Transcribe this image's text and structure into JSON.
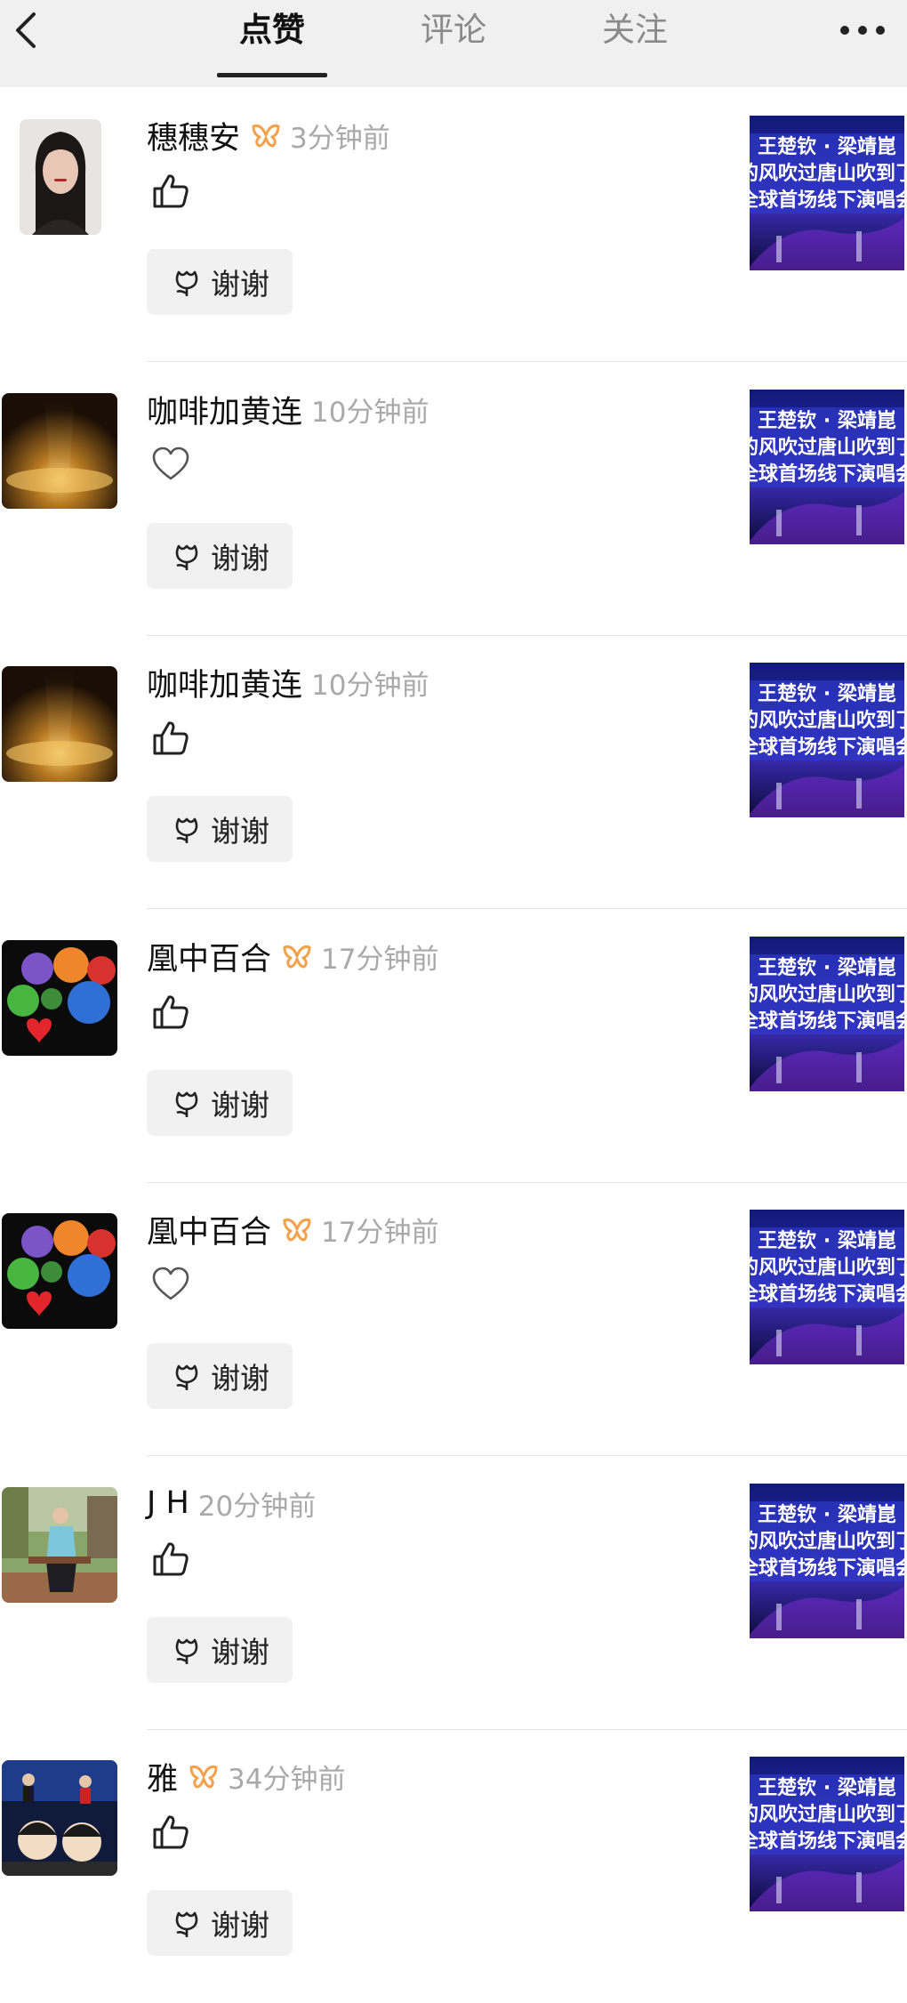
{
  "header": {
    "tabs": [
      {
        "label": "点赞",
        "active": true
      },
      {
        "label": "评论",
        "active": false
      },
      {
        "label": "关注",
        "active": false
      }
    ],
    "back_icon": "chevron-left-icon",
    "more_icon": "more-dots-icon"
  },
  "thanks_label": "谢谢",
  "thumb_text": {
    "line1": "王楚钦 · 梁靖崑",
    "line2": "的风吹过唐山吹到了",
    "line3": "全球首场线下演唱会"
  },
  "colors": {
    "vip_badge": "#f3a14a",
    "tab_active": "#111111",
    "tab_inactive": "#8a8a8a",
    "time_gray": "#a9a9a9"
  },
  "items": [
    {
      "name": "穗穗安",
      "vip": true,
      "time": "3分钟前",
      "reaction": "thumbs-up-icon",
      "avatar": "portrait"
    },
    {
      "name": "咖啡加黄连",
      "vip": false,
      "time": "10分钟前",
      "reaction": "heart-icon",
      "avatar": "gold"
    },
    {
      "name": "咖啡加黄连",
      "vip": false,
      "time": "10分钟前",
      "reaction": "thumbs-up-icon",
      "avatar": "gold"
    },
    {
      "name": "凰中百合",
      "vip": true,
      "time": "17分钟前",
      "reaction": "thumbs-up-icon",
      "avatar": "roses"
    },
    {
      "name": "凰中百合",
      "vip": true,
      "time": "17分钟前",
      "reaction": "heart-icon",
      "avatar": "roses"
    },
    {
      "name": "J H",
      "vip": false,
      "time": "20分钟前",
      "reaction": "thumbs-up-icon",
      "avatar": "outdoor"
    },
    {
      "name": "雅",
      "vip": true,
      "time": "34分钟前",
      "reaction": "thumbs-up-icon",
      "avatar": "pingpong"
    }
  ]
}
